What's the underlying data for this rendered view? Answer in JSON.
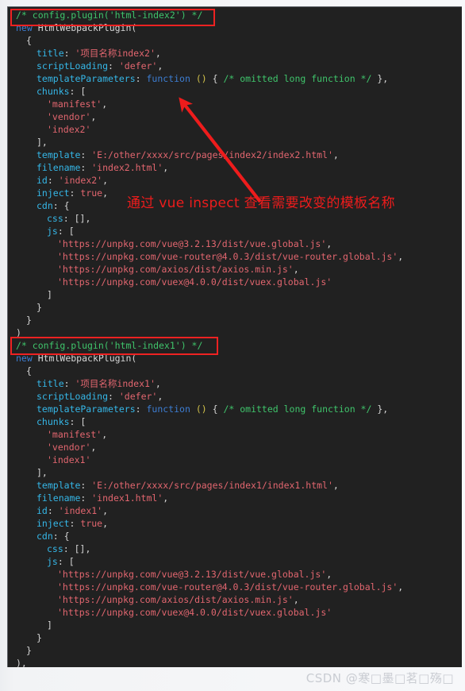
{
  "page": {
    "background_color": "#f5f6f8",
    "code_background_color": "#212121"
  },
  "theme": {
    "comment_color": "#3fc46b",
    "key_color": "#35b7e8",
    "keyword_color": "#3d7dd2",
    "string_color": "#e2666f",
    "plain_color": "#d5d5d5",
    "annotation_color": "#ee1c1c"
  },
  "annotations": {
    "box_index2_label": "config.plugin('html-index2') highlight box",
    "box_index1_label": "config.plugin('html-index1') highlight box",
    "arrow_label": "red arrow pointing to template path",
    "note_text": "通过 vue inspect 查看需要改变的模板名称"
  },
  "watermark": {
    "text": "CSDN @寒□墨□茗□殇□"
  },
  "code": {
    "language": "javascript",
    "lines": [
      {
        "id": "l1",
        "indent": 1,
        "text": "/* config.plugin('html-index2') */",
        "tokens": [
          {
            "t": "/* config.plugin('html-index2') */",
            "c": "tk-comment"
          }
        ]
      },
      {
        "id": "l2",
        "indent": 1,
        "text": "new HtmlWebpackPlugin(",
        "tokens": [
          {
            "t": "new",
            "c": "tk-keyword"
          },
          {
            "t": " HtmlWebpackPlugin(",
            "c": "tk-plain"
          }
        ]
      },
      {
        "id": "l3",
        "indent": 2,
        "text": "{",
        "tokens": [
          {
            "t": "{",
            "c": "tk-plain"
          }
        ]
      },
      {
        "id": "l4",
        "indent": 3,
        "text": "title: '项目名称index2',",
        "tokens": [
          {
            "t": "title",
            "c": "tk-key"
          },
          {
            "t": ": ",
            "c": "tk-plain"
          },
          {
            "t": "'项目名称index2'",
            "c": "tk-string"
          },
          {
            "t": ",",
            "c": "tk-plain"
          }
        ]
      },
      {
        "id": "l5",
        "indent": 3,
        "text": "scriptLoading: 'defer',",
        "tokens": [
          {
            "t": "scriptLoading",
            "c": "tk-key"
          },
          {
            "t": ": ",
            "c": "tk-plain"
          },
          {
            "t": "'defer'",
            "c": "tk-string"
          },
          {
            "t": ",",
            "c": "tk-plain"
          }
        ]
      },
      {
        "id": "l6",
        "indent": 3,
        "text": "templateParameters: function () { /* omitted long function */ },",
        "tokens": [
          {
            "t": "templateParameters",
            "c": "tk-key"
          },
          {
            "t": ": ",
            "c": "tk-plain"
          },
          {
            "t": "function",
            "c": "tk-fn"
          },
          {
            "t": " ",
            "c": "tk-plain"
          },
          {
            "t": "()",
            "c": "tk-paren"
          },
          {
            "t": " { ",
            "c": "tk-plain"
          },
          {
            "t": "/* omitted long function */",
            "c": "tk-comment"
          },
          {
            "t": " },",
            "c": "tk-plain"
          }
        ]
      },
      {
        "id": "l7",
        "indent": 3,
        "text": "chunks: [",
        "tokens": [
          {
            "t": "chunks",
            "c": "tk-key"
          },
          {
            "t": ": [",
            "c": "tk-plain"
          }
        ]
      },
      {
        "id": "l8",
        "indent": 4,
        "text": "'manifest',",
        "tokens": [
          {
            "t": "'manifest'",
            "c": "tk-string"
          },
          {
            "t": ",",
            "c": "tk-plain"
          }
        ]
      },
      {
        "id": "l9",
        "indent": 4,
        "text": "'vendor',",
        "tokens": [
          {
            "t": "'vendor'",
            "c": "tk-string"
          },
          {
            "t": ",",
            "c": "tk-plain"
          }
        ]
      },
      {
        "id": "l10",
        "indent": 4,
        "text": "'index2'",
        "tokens": [
          {
            "t": "'index2'",
            "c": "tk-string"
          }
        ]
      },
      {
        "id": "l11",
        "indent": 3,
        "text": "],",
        "tokens": [
          {
            "t": "],",
            "c": "tk-plain"
          }
        ]
      },
      {
        "id": "l12",
        "indent": 3,
        "text": "template: 'E:/other/xxxx/src/pages/index2/index2.html',",
        "tokens": [
          {
            "t": "template",
            "c": "tk-key"
          },
          {
            "t": ": ",
            "c": "tk-plain"
          },
          {
            "t": "'E:/other/xxxx/src/pages/index2/index2.html'",
            "c": "tk-string"
          },
          {
            "t": ",",
            "c": "tk-plain"
          }
        ]
      },
      {
        "id": "l13",
        "indent": 3,
        "text": "filename: 'index2.html',",
        "tokens": [
          {
            "t": "filename",
            "c": "tk-key"
          },
          {
            "t": ": ",
            "c": "tk-plain"
          },
          {
            "t": "'index2.html'",
            "c": "tk-string"
          },
          {
            "t": ",",
            "c": "tk-plain"
          }
        ]
      },
      {
        "id": "l14",
        "indent": 3,
        "text": "id: 'index2',",
        "tokens": [
          {
            "t": "id",
            "c": "tk-key"
          },
          {
            "t": ": ",
            "c": "tk-plain"
          },
          {
            "t": "'index2'",
            "c": "tk-string"
          },
          {
            "t": ",",
            "c": "tk-plain"
          }
        ]
      },
      {
        "id": "l15",
        "indent": 3,
        "text": "inject: true,",
        "tokens": [
          {
            "t": "inject",
            "c": "tk-key"
          },
          {
            "t": ": ",
            "c": "tk-plain"
          },
          {
            "t": "true",
            "c": "tk-bool"
          },
          {
            "t": ",",
            "c": "tk-plain"
          }
        ]
      },
      {
        "id": "l16",
        "indent": 3,
        "text": "cdn: {",
        "tokens": [
          {
            "t": "cdn",
            "c": "tk-key"
          },
          {
            "t": ": {",
            "c": "tk-plain"
          }
        ]
      },
      {
        "id": "l17",
        "indent": 4,
        "text": "css: [],",
        "tokens": [
          {
            "t": "css",
            "c": "tk-key"
          },
          {
            "t": ": [],",
            "c": "tk-plain"
          }
        ]
      },
      {
        "id": "l18",
        "indent": 4,
        "text": "js: [",
        "tokens": [
          {
            "t": "js",
            "c": "tk-key"
          },
          {
            "t": ": [",
            "c": "tk-plain"
          }
        ]
      },
      {
        "id": "l19",
        "indent": 5,
        "text": "'https://unpkg.com/vue@3.2.13/dist/vue.global.js',",
        "tokens": [
          {
            "t": "'https://unpkg.com/vue@3.2.13/dist/vue.global.js'",
            "c": "tk-string"
          },
          {
            "t": ",",
            "c": "tk-plain"
          }
        ]
      },
      {
        "id": "l20",
        "indent": 5,
        "text": "'https://unpkg.com/vue-router@4.0.3/dist/vue-router.global.js',",
        "tokens": [
          {
            "t": "'https://unpkg.com/vue-router@4.0.3/dist/vue-router.global.js'",
            "c": "tk-string"
          },
          {
            "t": ",",
            "c": "tk-plain"
          }
        ]
      },
      {
        "id": "l21",
        "indent": 5,
        "text": "'https://unpkg.com/axios/dist/axios.min.js',",
        "tokens": [
          {
            "t": "'https://unpkg.com/axios/dist/axios.min.js'",
            "c": "tk-string"
          },
          {
            "t": ",",
            "c": "tk-plain"
          }
        ]
      },
      {
        "id": "l22",
        "indent": 5,
        "text": "'https://unpkg.com/vuex@4.0.0/dist/vuex.global.js'",
        "tokens": [
          {
            "t": "'https://unpkg.com/vuex@4.0.0/dist/vuex.global.js'",
            "c": "tk-string"
          }
        ]
      },
      {
        "id": "l23",
        "indent": 4,
        "text": "]",
        "tokens": [
          {
            "t": "]",
            "c": "tk-plain"
          }
        ]
      },
      {
        "id": "l24",
        "indent": 3,
        "text": "}",
        "tokens": [
          {
            "t": "}",
            "c": "tk-plain"
          }
        ]
      },
      {
        "id": "l25",
        "indent": 2,
        "text": "}",
        "tokens": [
          {
            "t": "}",
            "c": "tk-plain"
          }
        ]
      },
      {
        "id": "l26",
        "indent": 1,
        "text": ")",
        "tokens": [
          {
            "t": ")",
            "c": "tk-plain"
          }
        ]
      },
      {
        "id": "l27",
        "indent": 1,
        "text": "/* config.plugin('html-index1') */",
        "tokens": [
          {
            "t": "/* config.plugin('html-index1') */",
            "c": "tk-comment"
          }
        ]
      },
      {
        "id": "l28",
        "indent": 1,
        "text": "new HtmlWebpackPlugin(",
        "tokens": [
          {
            "t": "new",
            "c": "tk-keyword"
          },
          {
            "t": " HtmlWebpackPlugin(",
            "c": "tk-plain"
          }
        ]
      },
      {
        "id": "l29",
        "indent": 2,
        "text": "{",
        "tokens": [
          {
            "t": "{",
            "c": "tk-plain"
          }
        ]
      },
      {
        "id": "l30",
        "indent": 3,
        "text": "title: '项目名称index1',",
        "tokens": [
          {
            "t": "title",
            "c": "tk-key"
          },
          {
            "t": ": ",
            "c": "tk-plain"
          },
          {
            "t": "'项目名称index1'",
            "c": "tk-string"
          },
          {
            "t": ",",
            "c": "tk-plain"
          }
        ]
      },
      {
        "id": "l31",
        "indent": 3,
        "text": "scriptLoading: 'defer',",
        "tokens": [
          {
            "t": "scriptLoading",
            "c": "tk-key"
          },
          {
            "t": ": ",
            "c": "tk-plain"
          },
          {
            "t": "'defer'",
            "c": "tk-string"
          },
          {
            "t": ",",
            "c": "tk-plain"
          }
        ]
      },
      {
        "id": "l32",
        "indent": 3,
        "text": "templateParameters: function () { /* omitted long function */ },",
        "tokens": [
          {
            "t": "templateParameters",
            "c": "tk-key"
          },
          {
            "t": ": ",
            "c": "tk-plain"
          },
          {
            "t": "function",
            "c": "tk-fn"
          },
          {
            "t": " ",
            "c": "tk-plain"
          },
          {
            "t": "()",
            "c": "tk-paren"
          },
          {
            "t": " { ",
            "c": "tk-plain"
          },
          {
            "t": "/* omitted long function */",
            "c": "tk-comment"
          },
          {
            "t": " },",
            "c": "tk-plain"
          }
        ]
      },
      {
        "id": "l33",
        "indent": 3,
        "text": "chunks: [",
        "tokens": [
          {
            "t": "chunks",
            "c": "tk-key"
          },
          {
            "t": ": [",
            "c": "tk-plain"
          }
        ]
      },
      {
        "id": "l34",
        "indent": 4,
        "text": "'manifest',",
        "tokens": [
          {
            "t": "'manifest'",
            "c": "tk-string"
          },
          {
            "t": ",",
            "c": "tk-plain"
          }
        ]
      },
      {
        "id": "l35",
        "indent": 4,
        "text": "'vendor',",
        "tokens": [
          {
            "t": "'vendor'",
            "c": "tk-string"
          },
          {
            "t": ",",
            "c": "tk-plain"
          }
        ]
      },
      {
        "id": "l36",
        "indent": 4,
        "text": "'index1'",
        "tokens": [
          {
            "t": "'index1'",
            "c": "tk-string"
          }
        ]
      },
      {
        "id": "l37",
        "indent": 3,
        "text": "],",
        "tokens": [
          {
            "t": "],",
            "c": "tk-plain"
          }
        ]
      },
      {
        "id": "l38",
        "indent": 3,
        "text": "template: 'E:/other/xxxx/src/pages/index1/index1.html',",
        "tokens": [
          {
            "t": "template",
            "c": "tk-key"
          },
          {
            "t": ": ",
            "c": "tk-plain"
          },
          {
            "t": "'E:/other/xxxx/src/pages/index1/index1.html'",
            "c": "tk-string"
          },
          {
            "t": ",",
            "c": "tk-plain"
          }
        ]
      },
      {
        "id": "l39",
        "indent": 3,
        "text": "filename: 'index1.html',",
        "tokens": [
          {
            "t": "filename",
            "c": "tk-key"
          },
          {
            "t": ": ",
            "c": "tk-plain"
          },
          {
            "t": "'index1.html'",
            "c": "tk-string"
          },
          {
            "t": ",",
            "c": "tk-plain"
          }
        ]
      },
      {
        "id": "l40",
        "indent": 3,
        "text": "id: 'index1',",
        "tokens": [
          {
            "t": "id",
            "c": "tk-key"
          },
          {
            "t": ": ",
            "c": "tk-plain"
          },
          {
            "t": "'index1'",
            "c": "tk-string"
          },
          {
            "t": ",",
            "c": "tk-plain"
          }
        ]
      },
      {
        "id": "l41",
        "indent": 3,
        "text": "inject: true,",
        "tokens": [
          {
            "t": "inject",
            "c": "tk-key"
          },
          {
            "t": ": ",
            "c": "tk-plain"
          },
          {
            "t": "true",
            "c": "tk-bool"
          },
          {
            "t": ",",
            "c": "tk-plain"
          }
        ]
      },
      {
        "id": "l42",
        "indent": 3,
        "text": "cdn: {",
        "tokens": [
          {
            "t": "cdn",
            "c": "tk-key"
          },
          {
            "t": ": {",
            "c": "tk-plain"
          }
        ]
      },
      {
        "id": "l43",
        "indent": 4,
        "text": "css: [],",
        "tokens": [
          {
            "t": "css",
            "c": "tk-key"
          },
          {
            "t": ": [],",
            "c": "tk-plain"
          }
        ]
      },
      {
        "id": "l44",
        "indent": 4,
        "text": "js: [",
        "tokens": [
          {
            "t": "js",
            "c": "tk-key"
          },
          {
            "t": ": [",
            "c": "tk-plain"
          }
        ]
      },
      {
        "id": "l45",
        "indent": 5,
        "text": "'https://unpkg.com/vue@3.2.13/dist/vue.global.js',",
        "tokens": [
          {
            "t": "'https://unpkg.com/vue@3.2.13/dist/vue.global.js'",
            "c": "tk-string"
          },
          {
            "t": ",",
            "c": "tk-plain"
          }
        ]
      },
      {
        "id": "l46",
        "indent": 5,
        "text": "'https://unpkg.com/vue-router@4.0.3/dist/vue-router.global.js',",
        "tokens": [
          {
            "t": "'https://unpkg.com/vue-router@4.0.3/dist/vue-router.global.js'",
            "c": "tk-string"
          },
          {
            "t": ",",
            "c": "tk-plain"
          }
        ]
      },
      {
        "id": "l47",
        "indent": 5,
        "text": "'https://unpkg.com/axios/dist/axios.min.js',",
        "tokens": [
          {
            "t": "'https://unpkg.com/axios/dist/axios.min.js'",
            "c": "tk-string"
          },
          {
            "t": ",",
            "c": "tk-plain"
          }
        ]
      },
      {
        "id": "l48",
        "indent": 5,
        "text": "'https://unpkg.com/vuex@4.0.0/dist/vuex.global.js'",
        "tokens": [
          {
            "t": "'https://unpkg.com/vuex@4.0.0/dist/vuex.global.js'",
            "c": "tk-string"
          }
        ]
      },
      {
        "id": "l49",
        "indent": 4,
        "text": "]",
        "tokens": [
          {
            "t": "]",
            "c": "tk-plain"
          }
        ]
      },
      {
        "id": "l50",
        "indent": 3,
        "text": "}",
        "tokens": [
          {
            "t": "}",
            "c": "tk-plain"
          }
        ]
      },
      {
        "id": "l51",
        "indent": 2,
        "text": "}",
        "tokens": [
          {
            "t": "}",
            "c": "tk-plain"
          }
        ]
      },
      {
        "id": "l52",
        "indent": 1,
        "text": "),",
        "tokens": [
          {
            "t": "),",
            "c": "tk-plain"
          }
        ]
      }
    ]
  }
}
